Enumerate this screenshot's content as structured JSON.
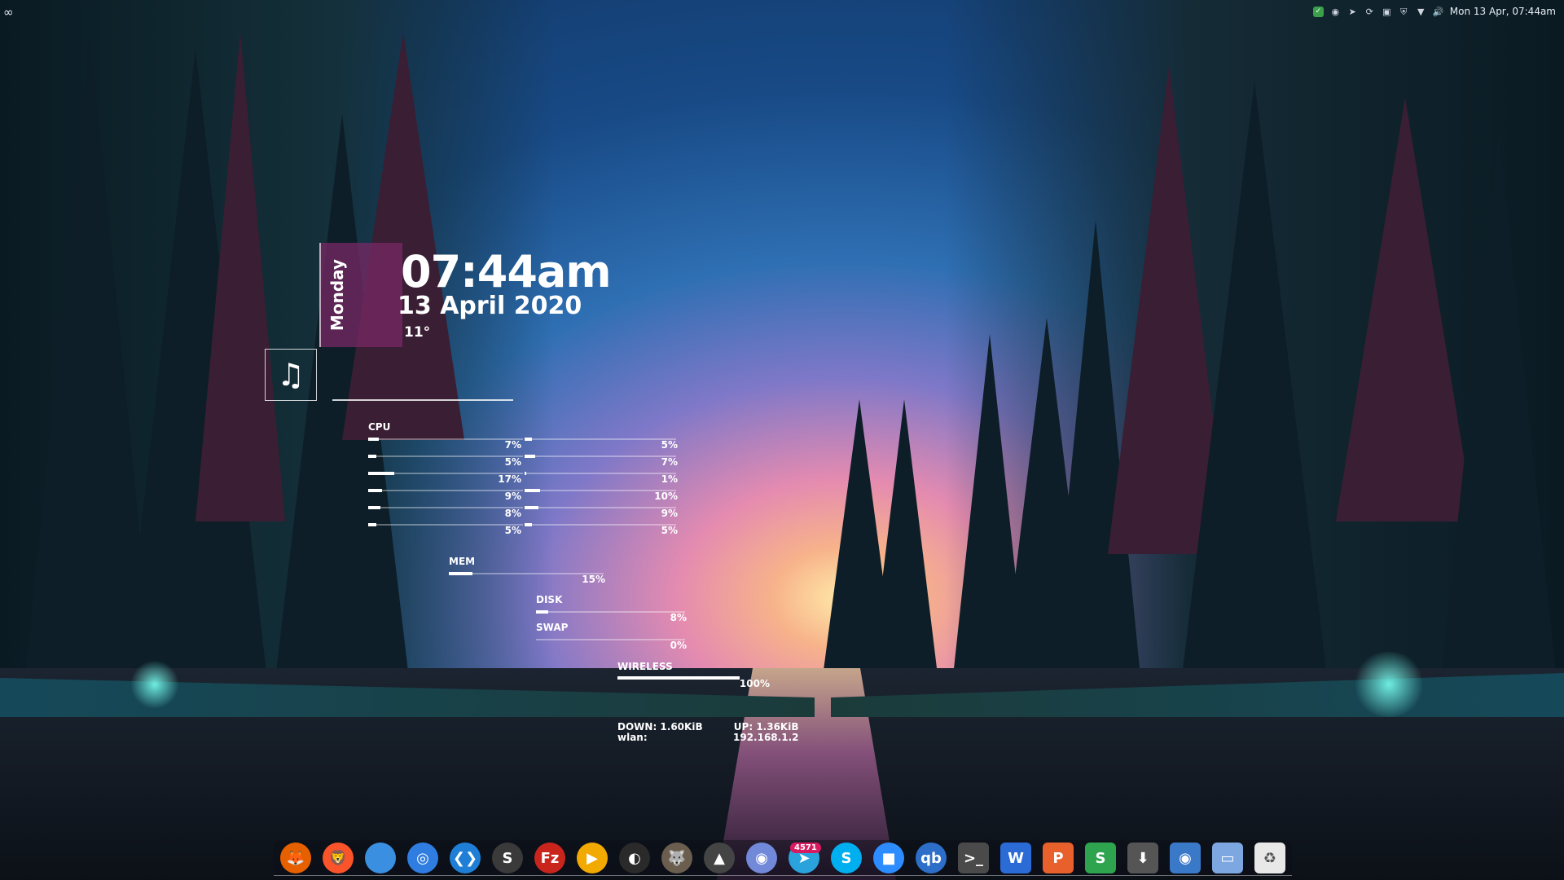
{
  "topbar": {
    "left_icon": "infinity-icon",
    "clock": "Mon 13 Apr, 07:44am",
    "tray_icons": [
      "shield-check-icon",
      "discord-icon",
      "telegram-icon",
      "sync-icon",
      "image-icon",
      "vpn-icon",
      "wifi-icon",
      "volume-icon"
    ]
  },
  "clock_widget": {
    "day": "Monday",
    "time": "07:44am",
    "date": "13 April 2020",
    "temperature": "11°"
  },
  "stats": {
    "cpu_label": "CPU",
    "cpu_left": [
      "7%",
      "5%",
      "17%",
      "9%",
      "8%",
      "5%"
    ],
    "cpu_right": [
      "5%",
      "7%",
      "1%",
      "10%",
      "9%",
      "5%"
    ],
    "cpu_left_values": [
      7,
      5,
      17,
      9,
      8,
      5
    ],
    "cpu_right_values": [
      5,
      7,
      1,
      10,
      9,
      5
    ],
    "mem_label": "MEM",
    "mem_pct": "15%",
    "mem_value": 15,
    "disk_label": "DISK",
    "disk_pct": "8%",
    "disk_value": 8,
    "swap_label": "SWAP",
    "swap_pct": "0%",
    "swap_value": 0,
    "wireless_label": "WIRELESS",
    "wireless_pct": "100%",
    "wireless_value": 100,
    "down": "DOWN: 1.60KiB",
    "iface": "wlan:",
    "up": "UP: 1.36KiB",
    "ip": "192.168.1.2"
  },
  "dock": {
    "apps": [
      {
        "name": "firefox",
        "glyph": "🦊",
        "color": "#e66000"
      },
      {
        "name": "brave",
        "glyph": "🦁",
        "color": "#fb542b"
      },
      {
        "name": "files",
        "glyph": "",
        "color": "#3b8fe0"
      },
      {
        "name": "web-browser",
        "glyph": "◎",
        "color": "#2f7de1"
      },
      {
        "name": "vscode",
        "glyph": "❮❯",
        "color": "#1f7fd6"
      },
      {
        "name": "simplenote",
        "glyph": "S",
        "color": "#3a3a3a"
      },
      {
        "name": "filezilla",
        "glyph": "Fz",
        "color": "#c9251d"
      },
      {
        "name": "media-player",
        "glyph": "▶",
        "color": "#f2a900"
      },
      {
        "name": "obs",
        "glyph": "◐",
        "color": "#2a2a2a"
      },
      {
        "name": "gimp",
        "glyph": "🐺",
        "color": "#6b5e4e"
      },
      {
        "name": "inkscape",
        "glyph": "▲",
        "color": "#444"
      },
      {
        "name": "discord",
        "glyph": "◉",
        "color": "#7289da"
      },
      {
        "name": "telegram",
        "glyph": "➤",
        "color": "#2aa3dc"
      },
      {
        "name": "skype",
        "glyph": "S",
        "color": "#00aff0"
      },
      {
        "name": "zoom",
        "glyph": "■",
        "color": "#2d8cff"
      },
      {
        "name": "qbittorrent",
        "glyph": "qb",
        "color": "#2d6ec8"
      },
      {
        "name": "terminal",
        "glyph": ">_",
        "color": "#4a4a4a"
      },
      {
        "name": "writer",
        "glyph": "W",
        "color": "#2b6bd6"
      },
      {
        "name": "presentation",
        "glyph": "P",
        "color": "#e8602c"
      },
      {
        "name": "spreadsheet",
        "glyph": "S",
        "color": "#2ea44f"
      },
      {
        "name": "updater",
        "glyph": "⬇",
        "color": "#555"
      },
      {
        "name": "toggle",
        "glyph": "◉",
        "color": "#3a78c8"
      },
      {
        "name": "screenshot",
        "glyph": "▭",
        "color": "#7da7e0"
      },
      {
        "name": "trash",
        "glyph": "♻",
        "color": "#e8e8e8"
      }
    ],
    "telegram_badge": "4571"
  }
}
